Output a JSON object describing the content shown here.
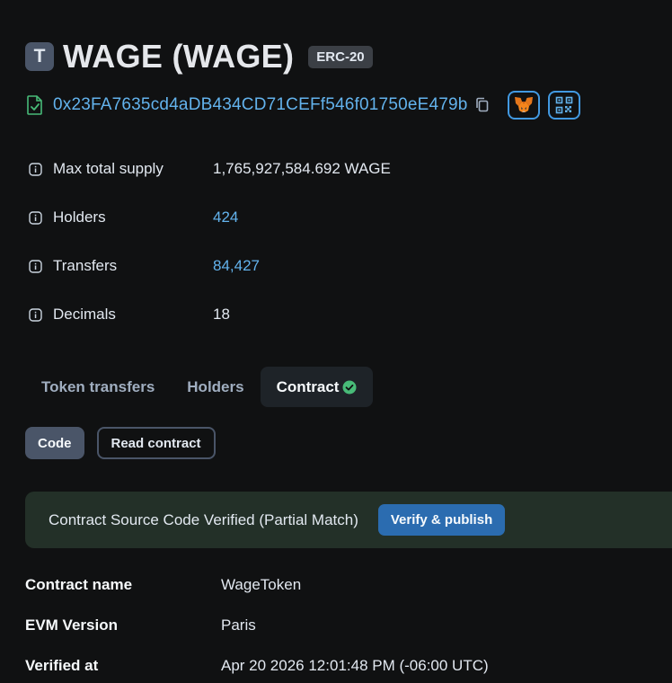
{
  "token": {
    "avatar_letter": "T",
    "title": "WAGE (WAGE)",
    "standard": "ERC-20",
    "address": "0x23FA7635cd4aDB434CD71CEFf546f01750eE479b"
  },
  "details": [
    {
      "label": "Max total supply",
      "value": "1,765,927,584.692 WAGE",
      "link": false
    },
    {
      "label": "Holders",
      "value": "424",
      "link": true
    },
    {
      "label": "Transfers",
      "value": "84,427",
      "link": true
    },
    {
      "label": "Decimals",
      "value": "18",
      "link": false
    }
  ],
  "tabs": [
    {
      "label": "Token transfers"
    },
    {
      "label": "Holders"
    },
    {
      "label": "Contract",
      "active": true
    }
  ],
  "subtabs": {
    "code": "Code",
    "read_contract": "Read contract"
  },
  "banner": {
    "text": "Contract Source Code Verified (Partial Match)",
    "button": "Verify & publish"
  },
  "contract_info": [
    {
      "label": "Contract name",
      "value": "WageToken"
    },
    {
      "label": "EVM Version",
      "value": "Paris"
    },
    {
      "label": "Verified at",
      "value": "Apr 20 2026 12:01:48 PM (-06:00 UTC)"
    }
  ],
  "colors": {
    "background": "#101112",
    "link": "#63b3ed",
    "accent_blue": "#4299e1",
    "verified_green": "#48bb78",
    "banner_bg": "#233028"
  },
  "icons": [
    "file-check-icon",
    "copy-icon",
    "metamask-icon",
    "qr-code-icon",
    "info-icon",
    "check-circle-icon"
  ]
}
